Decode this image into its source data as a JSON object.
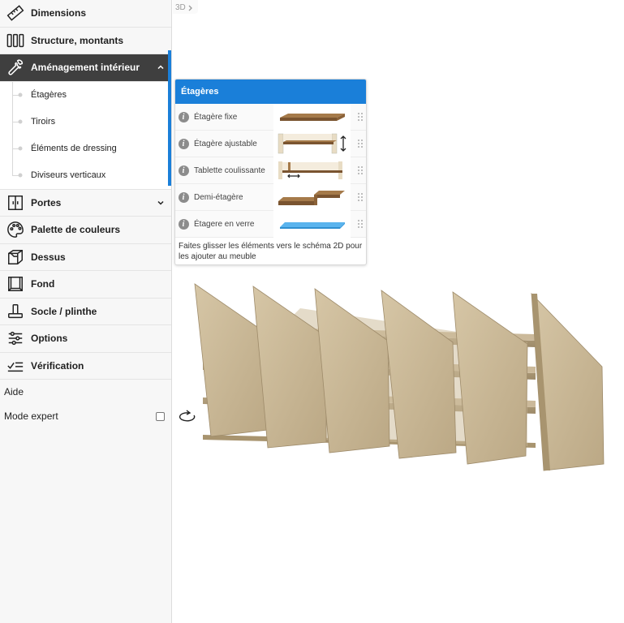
{
  "breadcrumb": {
    "label": "3D"
  },
  "sidebar": {
    "items": [
      {
        "label": "Dimensions",
        "icon": "ruler-icon"
      },
      {
        "label": "Structure, montants",
        "icon": "structure-icon"
      },
      {
        "label": "Aménagement intérieur",
        "icon": "wrench-icon",
        "active": true,
        "expanded": true
      },
      {
        "label": "Portes",
        "icon": "doors-icon",
        "expanded": false
      },
      {
        "label": "Palette de couleurs",
        "icon": "palette-icon"
      },
      {
        "label": "Dessus",
        "icon": "top-icon"
      },
      {
        "label": "Fond",
        "icon": "back-panel-icon"
      },
      {
        "label": "Socle / plinthe",
        "icon": "plinth-icon"
      },
      {
        "label": "Options",
        "icon": "sliders-icon"
      },
      {
        "label": "Vérification",
        "icon": "checklist-icon"
      }
    ],
    "sub_items": [
      "Étagères",
      "Tiroirs",
      "Éléments de dressing",
      "Diviseurs verticaux"
    ],
    "help_label": "Aide",
    "expert_mode_label": "Mode expert",
    "expert_mode_checked": false
  },
  "panel": {
    "title": "Étagères",
    "items": [
      {
        "label": "Étagère fixe",
        "thumb": "fixed-shelf"
      },
      {
        "label": "Étagère ajustable",
        "thumb": "adjustable-shelf"
      },
      {
        "label": "Tablette coulissante",
        "thumb": "sliding-shelf"
      },
      {
        "label": "Demi-étagère",
        "thumb": "half-shelf"
      },
      {
        "label": "Étagere en verre",
        "thumb": "glass-shelf"
      }
    ],
    "hint": "Faites glisser les éléments vers le schéma 2D pour les ajouter au meuble"
  },
  "colors": {
    "accent": "#1a7fd9",
    "active_bg": "#3f3f3f",
    "wood": "#c9b89a",
    "glass": "#5ab4ee"
  }
}
